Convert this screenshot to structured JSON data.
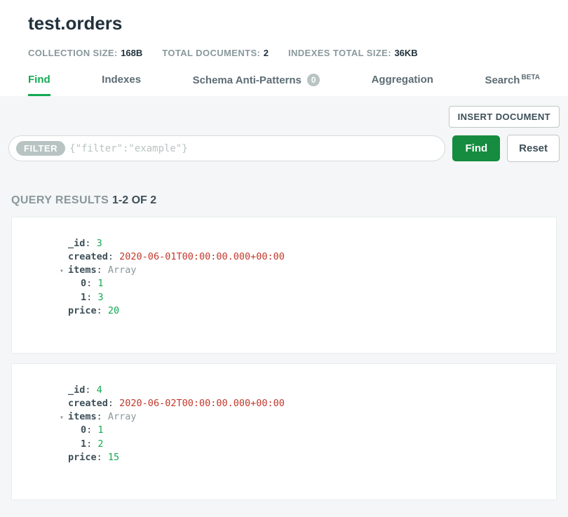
{
  "title": "test.orders",
  "stats": {
    "collection_size_label": "COLLECTION SIZE:",
    "collection_size_value": "168B",
    "total_documents_label": "TOTAL DOCUMENTS:",
    "total_documents_value": "2",
    "indexes_total_size_label": "INDEXES TOTAL SIZE:",
    "indexes_total_size_value": "36KB"
  },
  "tabs": {
    "find": "Find",
    "indexes": "Indexes",
    "schema": "Schema Anti-Patterns",
    "schema_badge": "0",
    "aggregation": "Aggregation",
    "search": "Search",
    "search_beta": "BETA"
  },
  "actions": {
    "insert_document": "INSERT DOCUMENT"
  },
  "filter": {
    "chip": "FILTER",
    "placeholder": "{\"filter\":\"example\"}",
    "find": "Find",
    "reset": "Reset"
  },
  "results": {
    "label": "QUERY RESULTS ",
    "count": "1-2 OF 2"
  },
  "docs": [
    {
      "fields": [
        {
          "key": "_id",
          "value": "3",
          "type": "num",
          "indent": 0
        },
        {
          "key": "created",
          "value": "2020-06-01T00:00:00.000+00:00",
          "type": "date",
          "indent": 0
        },
        {
          "key": "items",
          "value": "Array",
          "type": "type",
          "indent": 0,
          "caret": true
        },
        {
          "key": "0",
          "value": "1",
          "type": "num",
          "indent": 1
        },
        {
          "key": "1",
          "value": "3",
          "type": "num",
          "indent": 1
        },
        {
          "key": "price",
          "value": "20",
          "type": "num",
          "indent": 0
        }
      ]
    },
    {
      "fields": [
        {
          "key": "_id",
          "value": "4",
          "type": "num",
          "indent": 0
        },
        {
          "key": "created",
          "value": "2020-06-02T00:00:00.000+00:00",
          "type": "date",
          "indent": 0
        },
        {
          "key": "items",
          "value": "Array",
          "type": "type",
          "indent": 0,
          "caret": true
        },
        {
          "key": "0",
          "value": "1",
          "type": "num",
          "indent": 1
        },
        {
          "key": "1",
          "value": "2",
          "type": "num",
          "indent": 1
        },
        {
          "key": "price",
          "value": "15",
          "type": "num",
          "indent": 0
        }
      ]
    }
  ]
}
